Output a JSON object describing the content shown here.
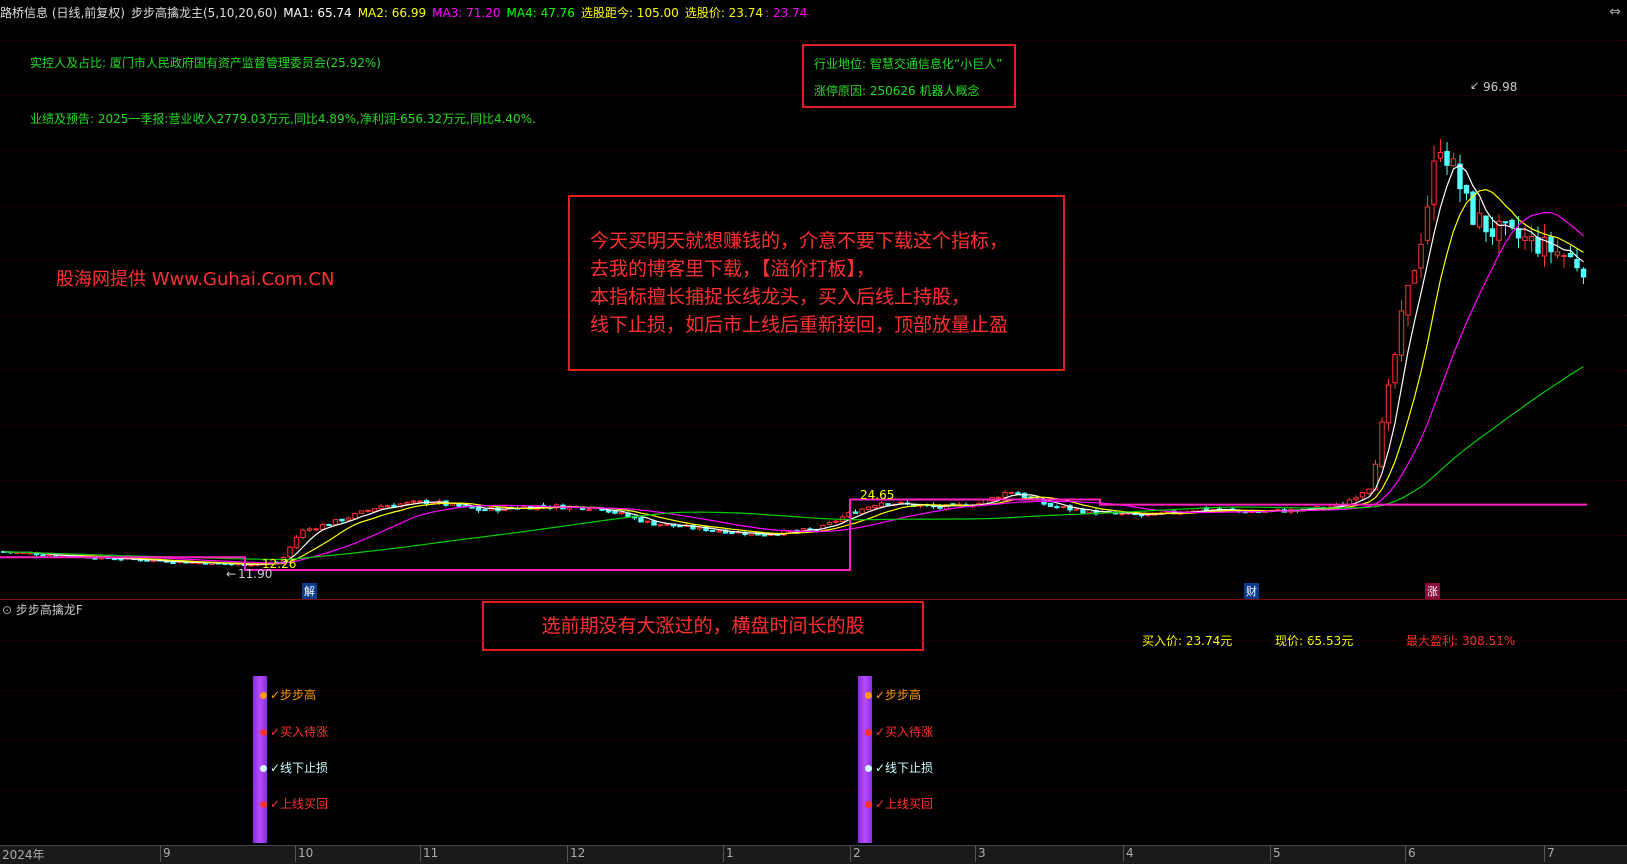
{
  "header": {
    "stock": "路桥信息 (日线,前复权)",
    "indicator": "步步高擒龙主(5,10,20,60)",
    "ma1": "MA1: 65.74",
    "ma2": "MA2: 66.99",
    "ma3": "MA3: 71.20",
    "ma4": "MA4: 47.76",
    "distance": "选股距今: 105.00",
    "pick_price": "选股价: 23.74",
    "pick_price2": ": 23.74"
  },
  "info": {
    "controller": "实控人及占比: 厦门市人民政府国有资产监督管理委员会(25.92%)",
    "earnings": "业绩及预告: 2025一季报:营业收入2779.03万元,同比4.89%,净利润-656.32万元,同比4.40%.",
    "industry": "行业地位: 智慧交通信息化“小巨人”",
    "limit_reason": "涨停原因: 250626 机器人概念",
    "source": "股海网提供 Www.Guhai.Com.CN"
  },
  "notes": {
    "line1": "今天买明天就想赚钱的，介意不要下载这个指标，",
    "line2": "去我的博客里下载，【溢价打板】，",
    "line3": "本指标擅长捕捉长线龙头，买入后线上持股，",
    "line4": "线下止损，如后市上线后重新接回，顶部放量止盈",
    "bottom": "选前期没有大涨过的，横盘时间长的股"
  },
  "sub_panel": {
    "title": "步步高擒龙F",
    "buy_price": "买入价: 23.74元",
    "current_price": "现价: 65.53元",
    "max_profit": "最大盈利: 308.51%",
    "signals": [
      "✓步步高",
      "✓买入待涨",
      "✓线下止损",
      "✓上线买回"
    ]
  },
  "price_labels": {
    "high": "96.98",
    "low": "11.90",
    "pick1": "12.26",
    "pick2": "24.65"
  },
  "markers": [
    "解",
    "财",
    "涨"
  ],
  "axis": {
    "months": [
      "2024年",
      "9",
      "10",
      "11",
      "12",
      "1",
      "2",
      "3",
      "4",
      "5",
      "6",
      "7"
    ]
  },
  "colors": {
    "ma1": "#ffffff",
    "ma2": "#ffff00",
    "ma3": "#ff00ff",
    "ma4": "#00cc00",
    "up": "#ff3232",
    "down": "#54ffff",
    "stop_line": "#ff20c0"
  },
  "chart_data": {
    "type": "candlestick",
    "y_range": [
      10,
      100
    ],
    "series": [
      {
        "name": "MA1",
        "last": 65.74
      },
      {
        "name": "MA2",
        "last": 66.99
      },
      {
        "name": "MA3",
        "last": 71.2
      },
      {
        "name": "MA4",
        "last": 47.76
      }
    ],
    "stop_line_levels": [
      14.5,
      12.26,
      24.65,
      23.74
    ],
    "annotations": {
      "high": 96.98,
      "low": 11.9
    }
  }
}
